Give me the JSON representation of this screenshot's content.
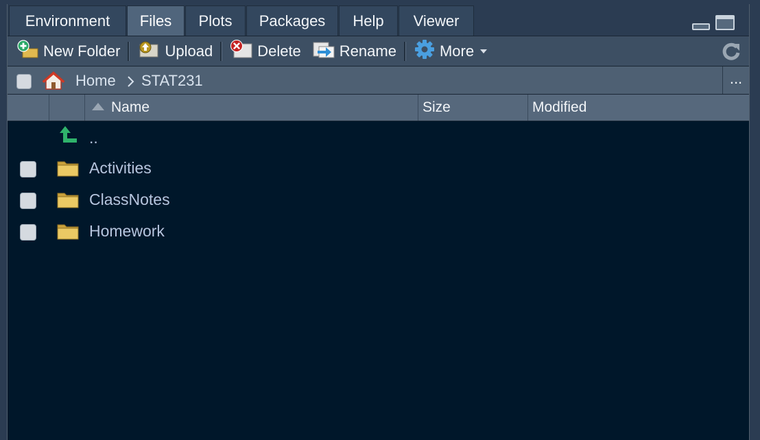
{
  "tabs": [
    {
      "label": "Environment",
      "active": false
    },
    {
      "label": "Files",
      "active": true
    },
    {
      "label": "Plots",
      "active": false
    },
    {
      "label": "Packages",
      "active": false
    },
    {
      "label": "Help",
      "active": false
    },
    {
      "label": "Viewer",
      "active": false
    }
  ],
  "toolbar": {
    "new_folder": "New Folder",
    "upload": "Upload",
    "delete": "Delete",
    "rename": "Rename",
    "more": "More"
  },
  "breadcrumb": {
    "home": "Home",
    "current": "STAT231",
    "more": "..."
  },
  "columns": {
    "name": "Name",
    "size": "Size",
    "modified": "Modified"
  },
  "rows": [
    {
      "name": "..",
      "type": "parent"
    },
    {
      "name": "Activities",
      "type": "folder"
    },
    {
      "name": "ClassNotes",
      "type": "folder"
    },
    {
      "name": "Homework",
      "type": "folder"
    }
  ],
  "colors": {
    "pane_background": "#00172a",
    "tab_active": "#50657c",
    "file_link": "#b7c5de",
    "folder_yellow": "#e8c35a",
    "parent_arrow": "#2fb36b"
  },
  "icons": {
    "new_folder": "new-folder-icon",
    "upload": "upload-icon",
    "delete": "delete-icon",
    "rename": "rename-icon",
    "more": "gear-icon",
    "refresh": "refresh-icon",
    "home": "home-icon",
    "parent": "parent-directory-icon",
    "folder": "folder-icon"
  }
}
